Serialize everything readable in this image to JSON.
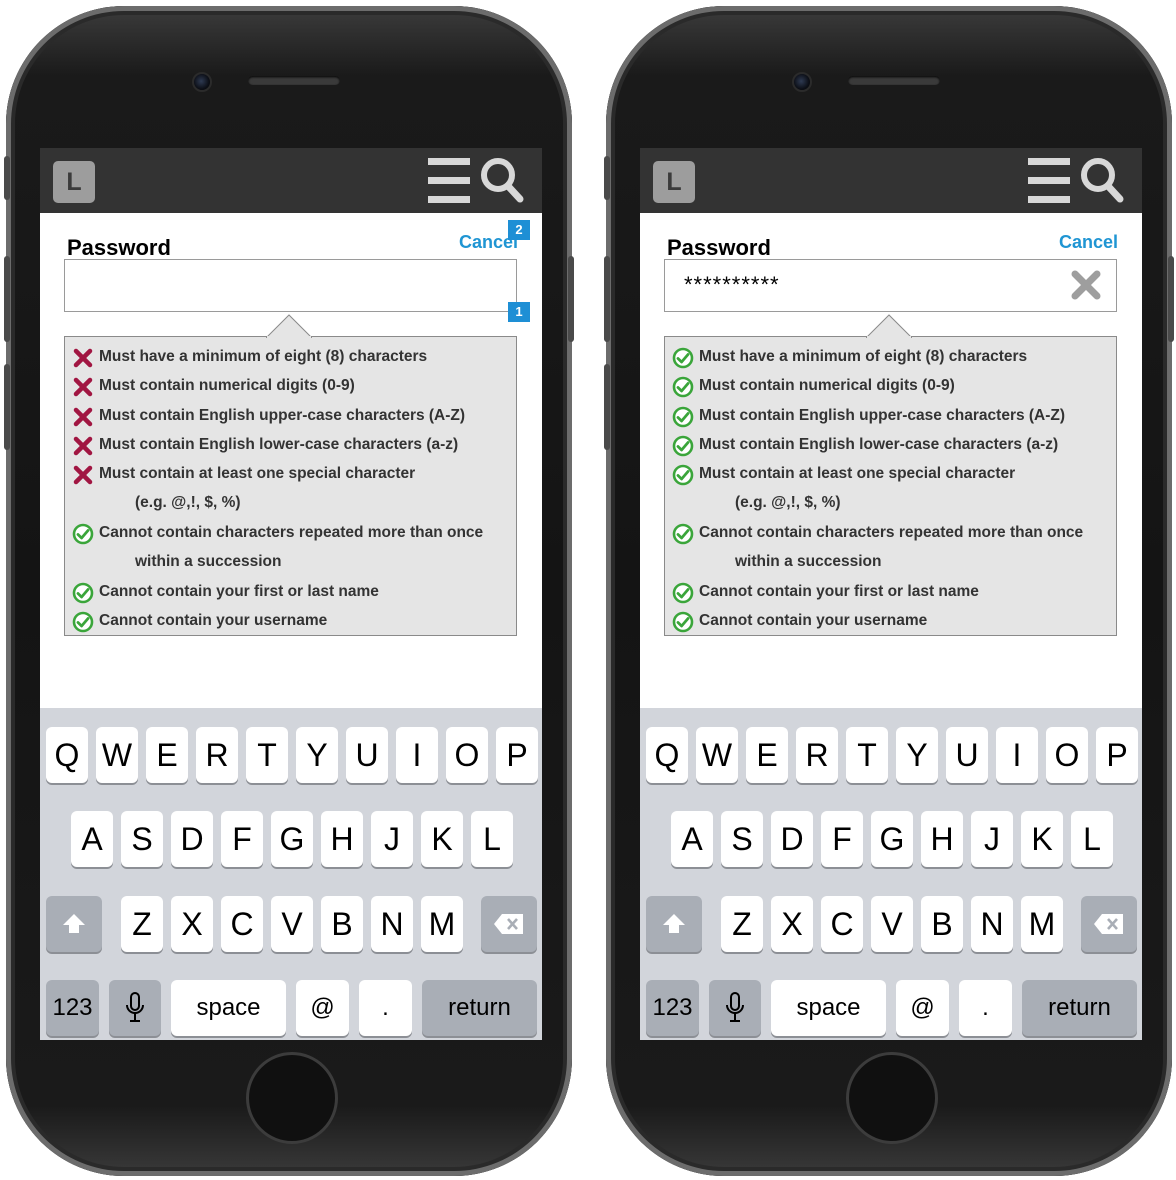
{
  "phones": [
    {
      "app": {
        "logo_letter": "L"
      },
      "form": {
        "label": "Password",
        "cancel_label": "Cancel",
        "password_value": "",
        "markers": [
          "2",
          "1"
        ]
      },
      "rules": [
        {
          "status": "fail",
          "text": "Must have a minimum of eight (8) characters"
        },
        {
          "status": "fail",
          "text": "Must contain numerical digits (0-9)"
        },
        {
          "status": "fail",
          "text": "Must contain English upper-case characters (A-Z)"
        },
        {
          "status": "fail",
          "text": "Must contain English lower-case characters (a-z)"
        },
        {
          "status": "fail",
          "text": "Must contain at least one special character",
          "sub": "(e.g. @,!, $, %)"
        },
        {
          "status": "pass",
          "text": "Cannot contain characters repeated more than once",
          "sub": "within a succession"
        },
        {
          "status": "pass",
          "text": "Cannot contain your first or last name"
        },
        {
          "status": "pass",
          "text": "Cannot contain your username"
        }
      ]
    },
    {
      "app": {
        "logo_letter": "L"
      },
      "form": {
        "label": "Password",
        "cancel_label": "Cancel",
        "password_value": "**********"
      },
      "rules": [
        {
          "status": "pass",
          "text": "Must have a minimum of eight (8) characters"
        },
        {
          "status": "pass",
          "text": "Must contain numerical digits (0-9)"
        },
        {
          "status": "pass",
          "text": "Must contain English upper-case characters (A-Z)"
        },
        {
          "status": "pass",
          "text": "Must contain English lower-case characters (a-z)"
        },
        {
          "status": "pass",
          "text": "Must contain at least one special character",
          "sub": "(e.g. @,!, $, %)"
        },
        {
          "status": "pass",
          "text": "Cannot contain characters repeated more than once",
          "sub": "within a succession"
        },
        {
          "status": "pass",
          "text": "Cannot contain your first or last name"
        },
        {
          "status": "pass",
          "text": "Cannot contain your username"
        }
      ]
    }
  ],
  "keyboard": {
    "row1": [
      "Q",
      "W",
      "E",
      "R",
      "T",
      "Y",
      "U",
      "I",
      "O",
      "P"
    ],
    "row2": [
      "A",
      "S",
      "D",
      "F",
      "G",
      "H",
      "J",
      "K",
      "L"
    ],
    "row3": [
      "Z",
      "X",
      "C",
      "V",
      "B",
      "N",
      "M"
    ],
    "numbers_label": "123",
    "space_label": "space",
    "at_label": "@",
    "dot_label": ".",
    "return_label": "return"
  },
  "colors": {
    "accent": "#1f95d3",
    "fail": "#a11642",
    "pass": "#3aa53a",
    "topbar": "#333333",
    "rules_bg": "#e5e5e5"
  }
}
